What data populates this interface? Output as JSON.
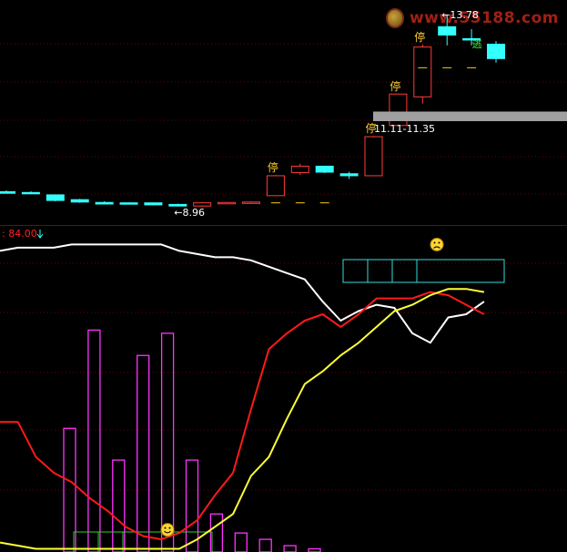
{
  "watermark": {
    "text": "www.55188.com"
  },
  "indicator_label": ": 84.00",
  "chart_data": [
    {
      "type": "candlestick",
      "panel": "price",
      "candles": [
        {
          "o": 9.34,
          "h": 9.37,
          "l": 9.29,
          "c": 9.3
        },
        {
          "o": 9.32,
          "h": 9.35,
          "l": 9.28,
          "c": 9.29
        },
        {
          "o": 9.26,
          "h": 9.27,
          "l": 9.1,
          "c": 9.12
        },
        {
          "o": 9.14,
          "h": 9.16,
          "l": 9.06,
          "c": 9.08
        },
        {
          "o": 9.07,
          "h": 9.1,
          "l": 9.02,
          "c": 9.03
        },
        {
          "o": 9.06,
          "h": 9.07,
          "l": 9.04,
          "c": 9.05
        },
        {
          "o": 9.06,
          "h": 9.07,
          "l": 9.0,
          "c": 9.01
        },
        {
          "o": 9.02,
          "h": 9.04,
          "l": 8.97,
          "c": 8.98
        },
        {
          "o": 8.98,
          "h": 9.08,
          "l": 8.96,
          "c": 9.06
        },
        {
          "o": 9.06,
          "h": 9.08,
          "l": 9.05,
          "c": 9.07
        },
        {
          "o": 9.05,
          "h": 9.1,
          "l": 9.04,
          "c": 9.08
        },
        {
          "o": 9.24,
          "h": 9.76,
          "l": 9.23,
          "c": 9.74
        },
        {
          "o": 9.82,
          "h": 10.04,
          "l": 9.76,
          "c": 9.98
        },
        {
          "o": 9.98,
          "h": 9.99,
          "l": 9.81,
          "c": 9.83
        },
        {
          "o": 9.79,
          "h": 9.84,
          "l": 9.66,
          "c": 9.74
        },
        {
          "o": 9.74,
          "h": 10.74,
          "l": 9.73,
          "c": 10.72
        },
        {
          "o": 11.0,
          "h": 11.8,
          "l": 10.99,
          "c": 11.79
        },
        {
          "o": 11.72,
          "h": 13.03,
          "l": 11.55,
          "c": 12.97
        },
        {
          "o": 13.48,
          "h": 13.78,
          "l": 13.01,
          "c": 13.27
        },
        {
          "o": 13.18,
          "h": 13.42,
          "l": 13.01,
          "c": 13.16
        },
        {
          "o": 13.04,
          "h": 13.12,
          "l": 12.58,
          "c": 12.68
        }
      ],
      "limit_up_marks": [
        {
          "index": 11,
          "label": "停"
        },
        {
          "index": 15,
          "label": "停"
        },
        {
          "index": 16,
          "label": "停"
        },
        {
          "index": 17,
          "label": "停"
        }
      ],
      "escape_mark": {
        "index": 19,
        "label": "逃"
      },
      "dash_marks": [
        {
          "index": 11,
          "price": 9.06
        },
        {
          "index": 12,
          "price": 9.06
        },
        {
          "index": 13,
          "price": 9.06
        },
        {
          "index": 17,
          "price": 12.45
        },
        {
          "index": 18,
          "price": 12.45
        },
        {
          "index": 19,
          "price": 12.45
        }
      ],
      "annotations": [
        {
          "text": "8.96",
          "index": 7,
          "price": 8.96,
          "arrow": "←"
        },
        {
          "text": "13.78",
          "index": 18,
          "price": 13.78,
          "arrow": "←"
        },
        {
          "text": "11.11-11.35",
          "range": [
            11.11,
            11.35
          ]
        }
      ],
      "ylim": [
        8.55,
        14.15
      ]
    },
    {
      "type": "line",
      "panel": "indicator",
      "ylim": [
        0,
        100
      ],
      "series": [
        {
          "color": "#ffffff",
          "values": [
            95,
            96,
            96,
            96,
            97,
            97,
            97,
            97,
            97,
            97,
            95,
            94,
            93,
            93,
            92,
            90,
            88,
            86,
            79,
            73,
            76,
            78,
            77,
            69,
            66,
            74,
            75,
            79
          ]
        },
        {
          "color": "#ff1a1a",
          "values": [
            41,
            41,
            30,
            25,
            22,
            17,
            13,
            8,
            5,
            4,
            6,
            10,
            18,
            25,
            45,
            64,
            69,
            73,
            75,
            71,
            75,
            80,
            80,
            80,
            82,
            81,
            78,
            75
          ]
        },
        {
          "color": "#ffff33",
          "values": [
            3,
            2,
            1,
            1,
            1,
            1,
            1,
            1,
            1,
            1,
            1,
            4,
            8,
            12,
            24,
            30,
            42,
            53,
            57,
            62,
            66,
            71,
            76,
            78,
            81,
            83,
            83,
            82
          ]
        }
      ],
      "bars": [
        {
          "index": 4,
          "value": 39
        },
        {
          "index": 5,
          "value": 70
        },
        {
          "index": 6,
          "value": 29
        },
        {
          "index": 7,
          "value": 62
        },
        {
          "index": 8,
          "value": 69
        },
        {
          "index": 9,
          "value": 29
        },
        {
          "index": 10,
          "value": 12
        },
        {
          "index": 11,
          "value": 6
        },
        {
          "index": 12,
          "value": 4
        },
        {
          "index": 13,
          "value": 2
        },
        {
          "index": 14,
          "value": 1
        }
      ],
      "bar_color": "#ff33ff",
      "bottom_box_color": "#33cc33",
      "top_box_color": "#33dddd",
      "markers": [
        {
          "type": "smiley",
          "index": 7,
          "value": 7
        },
        {
          "type": "sad",
          "index": 19,
          "value": 97
        }
      ]
    }
  ]
}
